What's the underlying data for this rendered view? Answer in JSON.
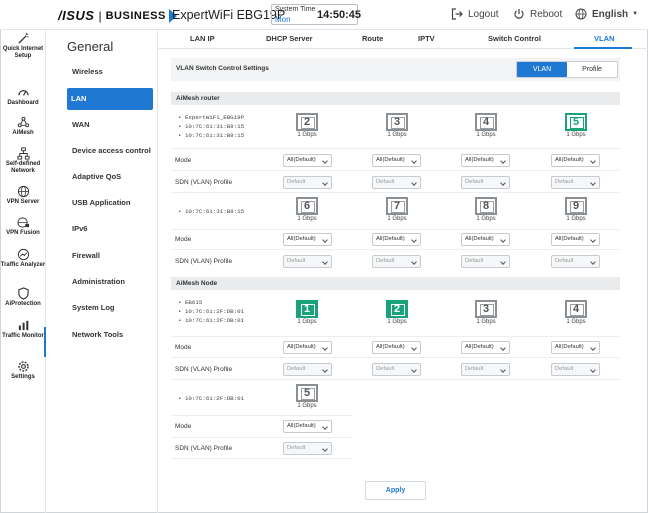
{
  "header": {
    "brand": "/ISUS",
    "brand_line": "BUSINESS",
    "model": "ExpertWiFi EBG19P",
    "system_time_label": "System Time",
    "system_day": "Mon",
    "system_time": "14:50:45",
    "logout_label": "Logout",
    "reboot_label": "Reboot",
    "language_label": "English",
    "accent_color": "#1f78d1"
  },
  "rail": {
    "items": [
      {
        "label": "Quick Internet Setup",
        "icon": "wand-icon"
      },
      {
        "label": "Dashboard",
        "icon": "dashboard-icon"
      },
      {
        "label": "AiMesh",
        "icon": "mesh-icon"
      },
      {
        "label": "Self-defined Network",
        "icon": "network-icon"
      },
      {
        "label": "VPN Server",
        "icon": "globe-icon"
      },
      {
        "label": "VPN Fusion",
        "icon": "globe-lock-icon"
      },
      {
        "label": "Traffic Analyzer",
        "icon": "chart-icon"
      },
      {
        "label": "AiProtection",
        "icon": "shield-icon"
      },
      {
        "label": "Traffic Monitor",
        "icon": "bars-icon"
      },
      {
        "label": "Settings",
        "icon": "gear-icon"
      }
    ]
  },
  "menu": {
    "title": "General",
    "items": [
      {
        "label": "Wireless"
      },
      {
        "label": "LAN",
        "active": true
      },
      {
        "label": "WAN"
      },
      {
        "label": "Device access control"
      },
      {
        "label": "Adaptive QoS"
      },
      {
        "label": "USB Application"
      },
      {
        "label": "IPv6"
      },
      {
        "label": "Firewall"
      },
      {
        "label": "Administration"
      },
      {
        "label": "System Log"
      },
      {
        "label": "Network Tools"
      }
    ]
  },
  "tabs": [
    {
      "label": "LAN IP"
    },
    {
      "label": "DHCP Server"
    },
    {
      "label": "Route"
    },
    {
      "label": "IPTV"
    },
    {
      "label": "Switch Control"
    },
    {
      "label": "VLAN",
      "active": true
    }
  ],
  "vlan": {
    "settings_label": "VLAN Switch Control Settings",
    "mode_vlan": "VLAN",
    "mode_profile": "Profile",
    "router": {
      "title": "AiMesh router",
      "group1_macs": [
        "ExpertWiFi_EBG19P",
        "10:7C:61:31:B9:15",
        "10:7C:61:31:B9:15"
      ],
      "group1_ports": [
        {
          "num": "2",
          "speed": "1 Gbps",
          "state": "off"
        },
        {
          "num": "3",
          "speed": "1 Gbps",
          "state": "off"
        },
        {
          "num": "4",
          "speed": "1 Gbps",
          "state": "off"
        },
        {
          "num": "5",
          "speed": "1 Gbps",
          "state": "up"
        }
      ],
      "group2_macs": [
        "10:7C:61:31:B9:15"
      ],
      "group2_ports": [
        {
          "num": "6",
          "speed": "1 Gbps",
          "state": "off"
        },
        {
          "num": "7",
          "speed": "1 Gbps",
          "state": "off"
        },
        {
          "num": "8",
          "speed": "1 Gbps",
          "state": "off"
        },
        {
          "num": "9",
          "speed": "1 Gbps",
          "state": "off"
        }
      ]
    },
    "node": {
      "title": "AiMesh Node",
      "group1_macs": [
        "EB615",
        "10:7C:61:2F:DB:01",
        "10:7C:61:2F:DB:01"
      ],
      "group1_ports": [
        {
          "num": "1",
          "speed": "1 Gbps",
          "state": "fill"
        },
        {
          "num": "2",
          "speed": "1 Gbps",
          "state": "fill"
        },
        {
          "num": "3",
          "speed": "1 Gbps",
          "state": "off"
        },
        {
          "num": "4",
          "speed": "1 Gbps",
          "state": "off"
        }
      ],
      "group2_macs": [
        "10:7C:61:2F:DB:01"
      ],
      "group2_ports": [
        {
          "num": "5",
          "speed": "1 Gbps",
          "state": "off"
        }
      ]
    },
    "mode_label": "Mode",
    "profile_label": "SDN (VLAN) Profile",
    "mode_value": "All(Default)",
    "profile_value": "Default",
    "apply_label": "Apply"
  }
}
